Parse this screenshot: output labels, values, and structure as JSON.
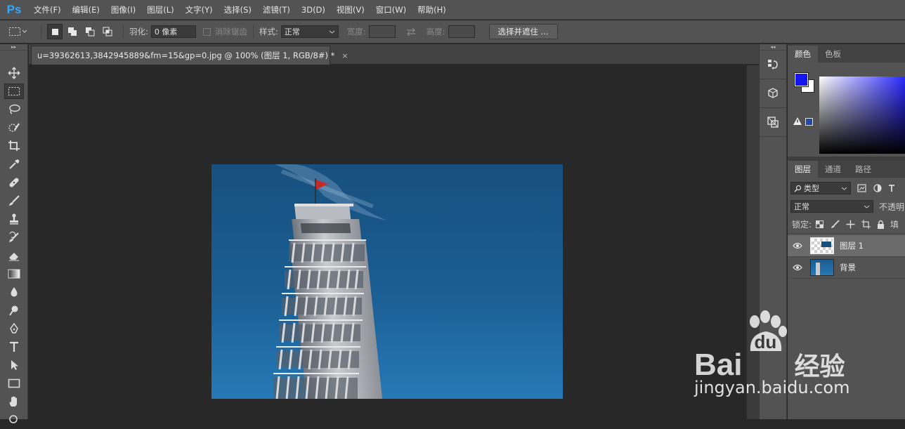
{
  "app": {
    "logo": "Ps"
  },
  "menu": [
    "文件(F)",
    "编辑(E)",
    "图像(I)",
    "图层(L)",
    "文字(Y)",
    "选择(S)",
    "滤镜(T)",
    "3D(D)",
    "视图(V)",
    "窗口(W)",
    "帮助(H)"
  ],
  "options": {
    "feather_label": "羽化:",
    "feather_value": "0 像素",
    "antialias_label": "消除锯齿",
    "style_label": "样式:",
    "style_value": "正常",
    "width_label": "宽度:",
    "height_label": "高度:",
    "select_mask_button": "选择并遮住 ..."
  },
  "document": {
    "tab_title": "u=39362613,3842945889&fm=15&gp=0.jpg @ 100% (图层 1, RGB/8#) *",
    "close_glyph": "×"
  },
  "color_panel": {
    "tabs": [
      "颜色",
      "色板"
    ],
    "foreground": "#1515f0",
    "background": "#ffffff"
  },
  "layers_panel": {
    "tabs": [
      "图层",
      "通道",
      "路径"
    ],
    "filter_kind": "类型",
    "blend_mode": "正常",
    "opacity_label": "不透明",
    "lock_label": "锁定:",
    "fill_label": "填",
    "layers": [
      {
        "name": "图层 1",
        "selected": true
      },
      {
        "name": "背景",
        "selected": false
      }
    ]
  },
  "watermark": {
    "logo_text": "Bai",
    "logo_text_2": "du",
    "cn": "经验",
    "url": "jingyan.baidu.com"
  }
}
